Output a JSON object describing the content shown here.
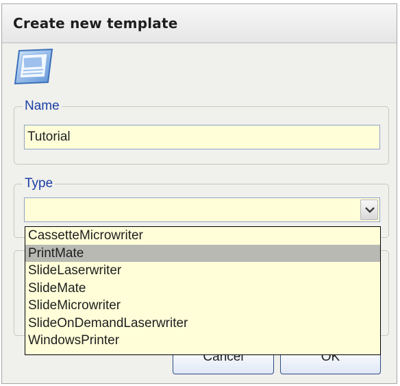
{
  "dialog": {
    "title": "Create new template",
    "icon": "template-document-icon"
  },
  "name_group": {
    "legend": "Name",
    "value": "Tutorial"
  },
  "type_group": {
    "legend": "Type",
    "selected_value": "",
    "options": [
      "CassetteMicrowriter",
      "PrintMate",
      "SlideLaserwriter",
      "SlideMate",
      "SlideMicrowriter",
      "SlideOnDemandLaserwriter",
      "WindowsPrinter"
    ],
    "highlighted_option": "PrintMate"
  },
  "buttons": {
    "cancel_label": "Cancel",
    "ok_label": "OK"
  },
  "colors": {
    "field_background": "#fffed9",
    "legend_text": "#1a3fa6",
    "highlight": "#b9b9b4"
  }
}
